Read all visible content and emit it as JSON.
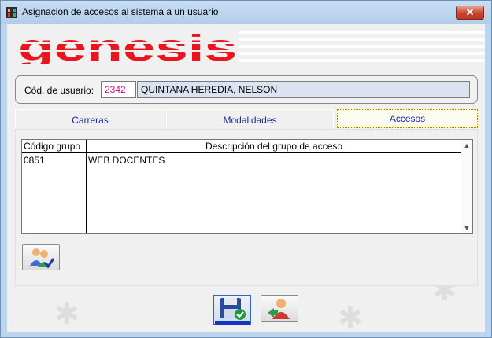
{
  "window": {
    "title": "Asignación de accesos al sistema a un usuario",
    "close_glyph": "✕",
    "app_icon": "film-strip-icon"
  },
  "brand": {
    "logo_text": "genesis",
    "logo_color": "#e8141e"
  },
  "user": {
    "label": "Cód. de usuario:",
    "code": "2342",
    "name": "QUINTANA HEREDIA, NELSON"
  },
  "tabs": [
    {
      "label": "Carreras",
      "active": false
    },
    {
      "label": "Modalidades",
      "active": false
    },
    {
      "label": "Accesos",
      "active": true
    }
  ],
  "grid": {
    "headers": [
      "Código grupo",
      "Descripción del grupo de acceso"
    ],
    "rows": [
      {
        "code": "0851",
        "description": "WEB DOCENTES"
      }
    ]
  },
  "buttons": {
    "group_users_icon": "users-check-icon",
    "save_icon": "floppy-check-icon",
    "exit_icon": "user-exit-icon"
  },
  "colors": {
    "accent": "#1733c4",
    "tab_text": "#1a2a9c",
    "code_text": "#c0197c",
    "name_bg": "#dde2f2"
  }
}
